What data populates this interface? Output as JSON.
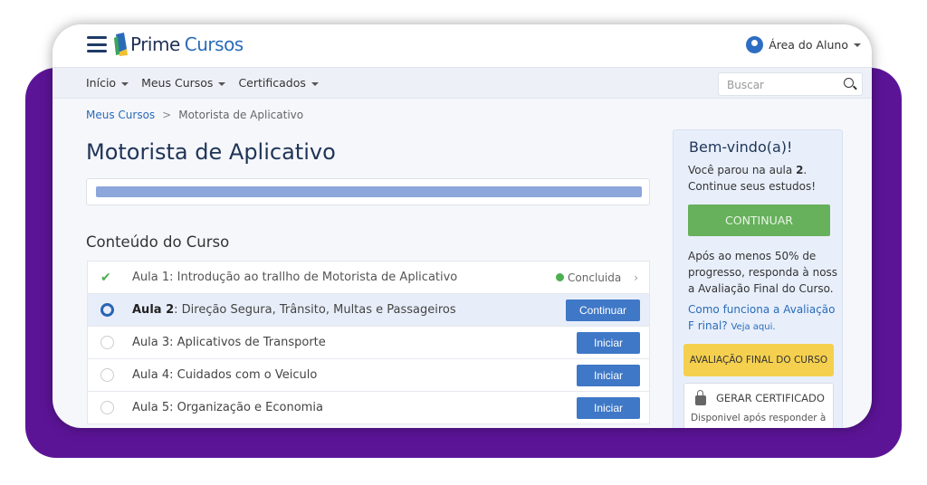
{
  "header": {
    "logo_part1": "Prime",
    "logo_part2": "Cursos",
    "user_menu": "Área do Aluno"
  },
  "nav": {
    "items": [
      {
        "label": "Início"
      },
      {
        "label": "Meus Cursos"
      },
      {
        "label": "Certificados"
      }
    ],
    "search_placeholder": "Buscar"
  },
  "breadcrumb": {
    "parent": "Meus Cursos",
    "separator": ">",
    "current": "Motorista de Aplicativo"
  },
  "page_title": "Motorista de Aplicativo",
  "progress_percent": 100,
  "content_title": "Conteúdo do Curso",
  "lessons": [
    {
      "num": "Aula 1:",
      "title": " Introdução ao trallho de Motorista de Aplicativo",
      "status": "Concluida"
    },
    {
      "num": "Aula 2",
      "title": ": Direção Segura, Trânsito, Multas e Passageiros",
      "button": "Continuar"
    },
    {
      "num": "Aula 3:",
      "title": " Aplicativos de Transporte",
      "button": "Iniciar"
    },
    {
      "num": "Aula 4:",
      "title": " Cuidados com o Veiculo",
      "button": "Iniciar"
    },
    {
      "num": "Aula 5:",
      "title": " Organização e Economia",
      "button": "Iniciar"
    }
  ],
  "sidebar": {
    "welcome": "Bem-vindo(a)!",
    "stopped_pre": "Você parou na aula ",
    "stopped_num": "2",
    "stopped_post": ". Continue seus estudos!",
    "continue_button": "CONTINUAR",
    "info": "Após ao menos 50% de progresso, responda à noss a Avaliação Final do Curso.",
    "link": "Como funciona a Avaliação F rinal?",
    "link_small": "Veja aqui.",
    "final_button": "AVALIAÇÃO FINAL DO CURSO",
    "cert_title": "GERAR CERTIFICADO",
    "cert_desc": "Disponivel após responder à"
  },
  "colors": {
    "purple": "#5c1497",
    "primary": "#3f78c7",
    "success": "#67b05c",
    "warning": "#f5d04f"
  }
}
